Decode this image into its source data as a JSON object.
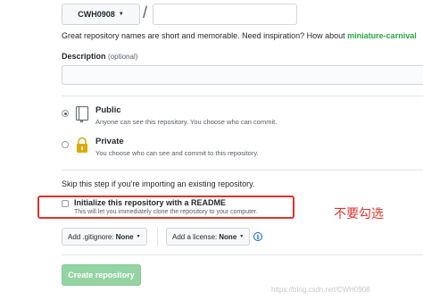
{
  "owner": {
    "label": "CWH0908"
  },
  "separator": "/",
  "repo_name": {
    "value": ""
  },
  "inspiration": {
    "text": "Great repository names are short and memorable. Need inspiration? How about ",
    "suggestion": "miniature-carnival"
  },
  "description": {
    "label": "Description",
    "optional": "(optional)",
    "value": ""
  },
  "visibility": {
    "public": {
      "title": "Public",
      "desc": "Anyone can see this repository. You choose who can commit.",
      "checked": true
    },
    "private": {
      "title": "Private",
      "desc": "You choose who can see and commit to this repository.",
      "checked": false
    }
  },
  "skip_text": "Skip this step if you’re importing an existing repository.",
  "readme": {
    "title": "Initialize this repository with a README",
    "desc": "This will let you immediately clone the repository to your computer.",
    "checked": false
  },
  "annotation": "不要勾选",
  "gitignore": {
    "label": "Add .gitignore:",
    "value": "None"
  },
  "license": {
    "label": "Add a license:",
    "value": "None"
  },
  "create_button": "Create repository",
  "watermark": "https://blog.csdn.net/CWH0908",
  "colors": {
    "accent_green": "#28a745",
    "annotation_red": "#e0342c",
    "link_blue": "#0366d6"
  }
}
